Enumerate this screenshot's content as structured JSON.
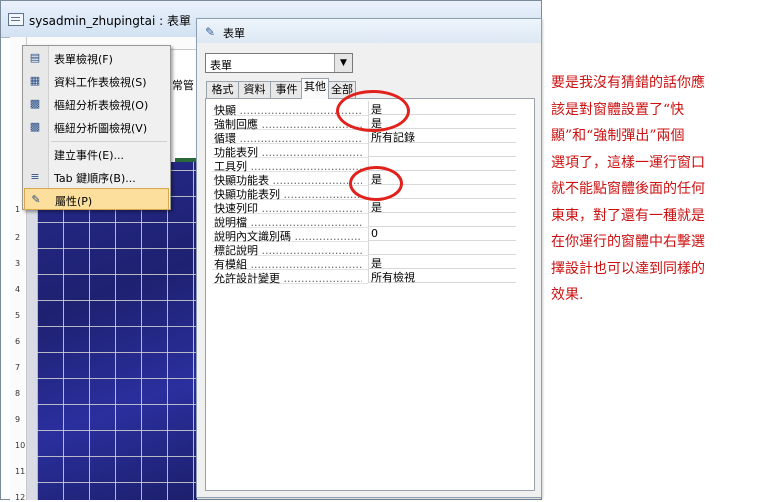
{
  "form_window": {
    "title": "sysadmin_zhupingtai : 表單",
    "icon": "form-icon",
    "section_label": "常管",
    "ruler_numbers": [
      "1",
      "2",
      "3",
      "4",
      "5",
      "6",
      "7",
      "8",
      "9",
      "10",
      "11",
      "12"
    ]
  },
  "context_menu": {
    "items": [
      {
        "label": "表單檢視(F)",
        "icon": "form-view-icon"
      },
      {
        "label": "資料工作表檢視(S)",
        "icon": "datasheet-icon"
      },
      {
        "label": "樞紐分析表檢視(O)",
        "icon": "pivot-table-icon"
      },
      {
        "label": "樞紐分析圖檢視(V)",
        "icon": "pivot-chart-icon"
      },
      {
        "label": "建立事件(E)...",
        "icon": ""
      },
      {
        "label": "Tab 鍵順序(B)...",
        "icon": "tab-order-icon"
      },
      {
        "label": "屬性(P)",
        "icon": "properties-icon",
        "selected": true
      }
    ]
  },
  "property_sheet": {
    "title": "表單",
    "selector_value": "表單",
    "tabs": [
      "格式",
      "資料",
      "事件",
      "其他",
      "全部"
    ],
    "active_tab": "其他",
    "rows": [
      {
        "name": "快顯",
        "value": "是"
      },
      {
        "name": "強制回應",
        "value": "是"
      },
      {
        "name": "循環",
        "value": "所有記錄"
      },
      {
        "name": "功能表列",
        "value": ""
      },
      {
        "name": "工具列",
        "value": ""
      },
      {
        "name": "快顯功能表",
        "value": "是"
      },
      {
        "name": "快顯功能表列",
        "value": ""
      },
      {
        "name": "快速列印",
        "value": "是"
      },
      {
        "name": "說明檔",
        "value": ""
      },
      {
        "name": "說明內文識別碼",
        "value": "0"
      },
      {
        "name": "標記說明",
        "value": ""
      },
      {
        "name": "有模組",
        "value": "是"
      },
      {
        "name": "允許設計變更",
        "value": "所有檢視"
      }
    ]
  },
  "annotation": {
    "color": "#cc1111",
    "lines": [
      "要是我沒有猜錯的話你應",
      "該是對窗體設置了“快",
      "顯”和“強制彈出”兩個",
      "選項了，這樣一運行窗口",
      "就不能點窗體後面的任何",
      "東東，對了還有一種就是",
      "在你運行的窗體中右擊選",
      "擇設計也可以達到同樣的",
      "效果."
    ]
  }
}
